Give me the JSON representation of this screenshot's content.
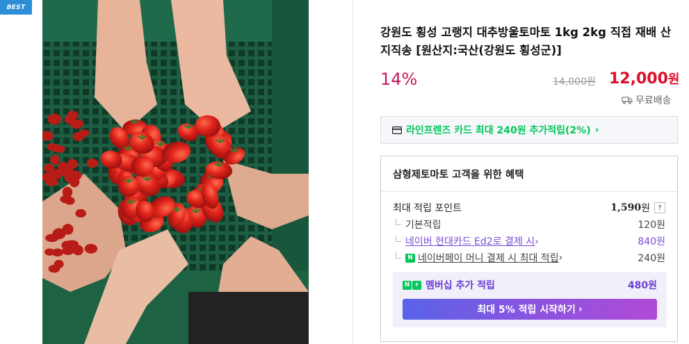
{
  "badge": "BEST",
  "product": {
    "title": "강원도 횡성 고랭지 대추방울토마토 1kg 2kg 직접 재배 산지직송 [원산지:국산(강원도 횡성군)]",
    "discount": "14%",
    "original_price": "14,000원",
    "price": "12,000",
    "price_unit": "원",
    "shipping": "무료배송"
  },
  "card_promo": {
    "text": "라인프렌즈 카드 최대 240원 추가적립(2%)",
    "chevron": "›"
  },
  "benefits": {
    "title": "삼형제토마토 고객을 위한 혜택",
    "max_points_label": "최대 적립 포인트",
    "max_points_value": "1,590",
    "max_points_unit": "원",
    "help": "?",
    "rows": [
      {
        "label": "기본적립",
        "value": "120원"
      },
      {
        "label": "네이버 현대카드 Ed2로 결제 시",
        "chevron": "›",
        "value": "840원"
      },
      {
        "label": "네이버페이 머니 결제 시 최대 적립",
        "chevron": "›",
        "value": "240원",
        "icon_letter": "N"
      }
    ],
    "membership": {
      "label": "멤버십 추가 적립",
      "value": "480원",
      "icon_n": "N",
      "icon_plus": "+",
      "button_label": "최대 5% 적립 시작하기",
      "button_chevron": "›"
    }
  },
  "colors": {
    "brand_green": "#03c75a",
    "price_red": "#e00d2c",
    "discount_pink": "#c2185b",
    "membership_purple": "#6b3fd4",
    "badge_blue": "#2d8ed8"
  }
}
